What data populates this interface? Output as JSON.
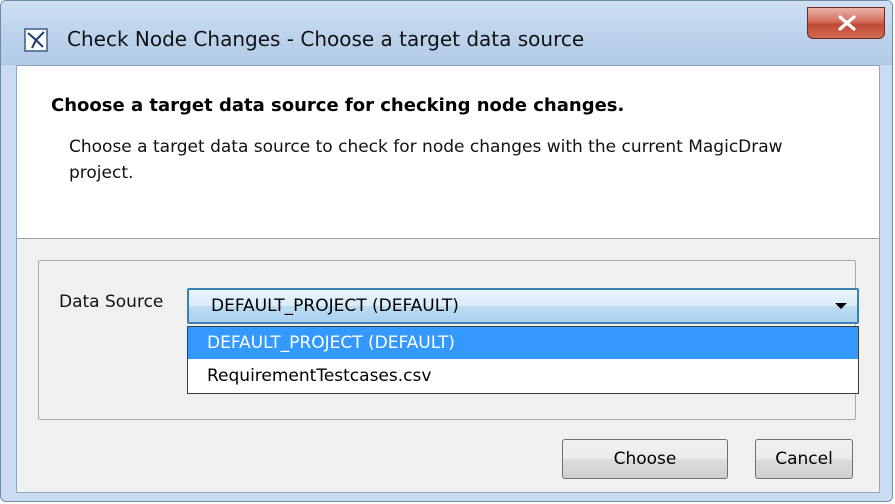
{
  "window": {
    "title": "Check Node Changes - Choose a target data source",
    "app_icon": "magicdraw-app-icon",
    "close_icon": "close-x-icon"
  },
  "header": {
    "title": "Choose a target data source for checking node changes.",
    "description": "Choose a target data source to check for node changes with the current MagicDraw project."
  },
  "form": {
    "data_source_label": "Data Source",
    "selected_value": "DEFAULT_PROJECT (DEFAULT)",
    "options": [
      {
        "label": "DEFAULT_PROJECT (DEFAULT)",
        "highlighted": true
      },
      {
        "label": "RequirementTestcases.csv",
        "highlighted": false
      }
    ]
  },
  "buttons": {
    "choose_label": "Choose",
    "cancel_label": "Cancel"
  },
  "colors": {
    "highlight": "#3399ff",
    "close_button": "#c8503a"
  }
}
